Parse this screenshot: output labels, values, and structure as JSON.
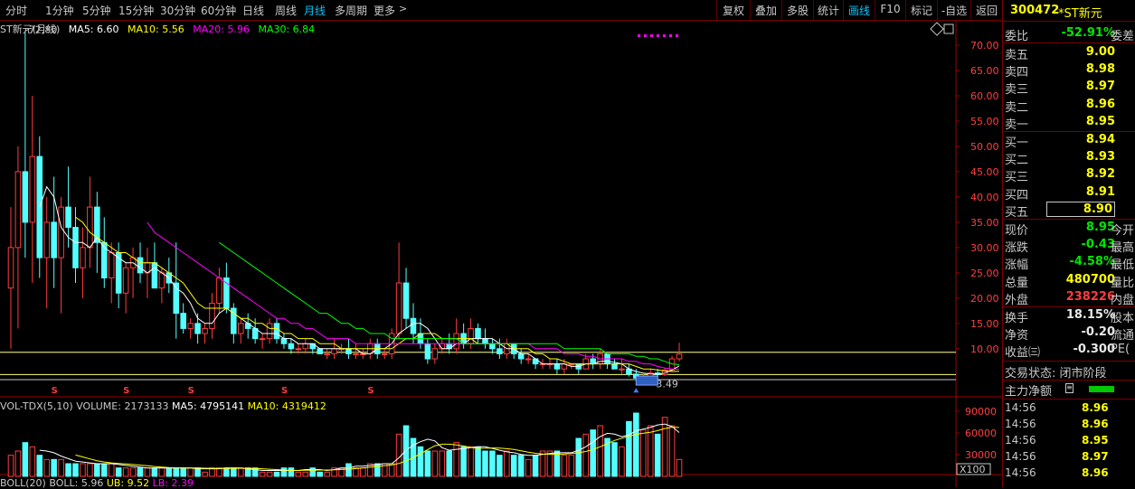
{
  "toolbar": {
    "periods": [
      "分时",
      "1分钟",
      "5分钟",
      "15分钟",
      "30分钟",
      "60分钟",
      "日线",
      "周线",
      "月线",
      "多周期",
      "更多"
    ],
    "active_period": "月线",
    "more_icon": "chevron-right-icon",
    "tools": [
      "复权",
      "叠加",
      "多股",
      "统计",
      "画线",
      "F10",
      "标记",
      "-自选",
      "返回"
    ],
    "active_tool": "画线"
  },
  "legend": {
    "title": "ST新元(月线)",
    "ma5": "MA5: 6.60",
    "ma10": "MA10: 5.56",
    "ma20": "MA20: 5.96",
    "ma30": "MA30: 6.84",
    "high_label": "72.80",
    "low_label": "3.49"
  },
  "volume_legend": {
    "name": "VOL-TDX(5,10)",
    "volume": "VOLUME: 2173133",
    "ma5": "MA5: 4795141",
    "ma10": "MA10: 4319412"
  },
  "boll_legend": {
    "name": "BOLL(20)",
    "boll": "BOLL: 5.96",
    "ub": "UB: 9.52",
    "lb": "LB: 2.39"
  },
  "colors": {
    "up": "#ff3c3c",
    "down": "#54ffff",
    "ma5": "#ffffff",
    "ma10": "#ffff00",
    "ma20": "#ff00ff",
    "ma30": "#00ff00",
    "axis": "#a00000"
  },
  "chart_data": {
    "type": "candlestick",
    "price_axis": {
      "ticks": [
        "70.00",
        "65.00",
        "60.00",
        "55.00",
        "50.00",
        "45.00",
        "40.00",
        "35.00",
        "30.00",
        "25.00",
        "20.00",
        "15.00",
        "10.00"
      ],
      "range": [
        3.0,
        75.0
      ]
    },
    "volume_axis": {
      "ticks": [
        "90000",
        "60000",
        "30000"
      ],
      "unit": "X100",
      "range": [
        0,
        100000
      ]
    },
    "horizontal_lines": [
      9.3,
      4.9
    ],
    "ohlc": [
      [
        22,
        38,
        10,
        30
      ],
      [
        30,
        50,
        14,
        45
      ],
      [
        45,
        72.8,
        28,
        35
      ],
      [
        35,
        60,
        23,
        48
      ],
      [
        48,
        52,
        24,
        28
      ],
      [
        28,
        40,
        18,
        35
      ],
      [
        35,
        44,
        22,
        28
      ],
      [
        28,
        40,
        17,
        38
      ],
      [
        38,
        46,
        30,
        34
      ],
      [
        34,
        38,
        23,
        26
      ],
      [
        26,
        34,
        20,
        30
      ],
      [
        30,
        44,
        26,
        38
      ],
      [
        38,
        41,
        25,
        31
      ],
      [
        31,
        36,
        22,
        24
      ],
      [
        24,
        31,
        19,
        29
      ],
      [
        29,
        31,
        18,
        21
      ],
      [
        21,
        27,
        17,
        26
      ],
      [
        26,
        30,
        20,
        28
      ],
      [
        28,
        31,
        23,
        25
      ],
      [
        25,
        30,
        20,
        27
      ],
      [
        27,
        31,
        22,
        22
      ],
      [
        22,
        26,
        19,
        25
      ],
      [
        25,
        28,
        21,
        23
      ],
      [
        23,
        31,
        12,
        17
      ],
      [
        17,
        19,
        13,
        14
      ],
      [
        14,
        16,
        12,
        15
      ],
      [
        15,
        17,
        11,
        13
      ],
      [
        13,
        15,
        11,
        14
      ],
      [
        14,
        21,
        12,
        19
      ],
      [
        19,
        26,
        17,
        24
      ],
      [
        24,
        27,
        17,
        18
      ],
      [
        18,
        19,
        11,
        13
      ],
      [
        13,
        16,
        11,
        15
      ],
      [
        15,
        17,
        12,
        14
      ],
      [
        14,
        16,
        11,
        12
      ],
      [
        12,
        13,
        10,
        12
      ],
      [
        12,
        16,
        11,
        15
      ],
      [
        15,
        16,
        11,
        12
      ],
      [
        12,
        13,
        10,
        11
      ],
      [
        11,
        12,
        9,
        10
      ],
      [
        10,
        11,
        9,
        10
      ],
      [
        10,
        12,
        9,
        11
      ],
      [
        11,
        11,
        9,
        10
      ],
      [
        10,
        10,
        9,
        9
      ],
      [
        9,
        10,
        8,
        9
      ],
      [
        9,
        12,
        8,
        10
      ],
      [
        10,
        11,
        9,
        10
      ],
      [
        10,
        12,
        8,
        9
      ],
      [
        9,
        11,
        8,
        9
      ],
      [
        9,
        10,
        8,
        9
      ],
      [
        9,
        12,
        8,
        11
      ],
      [
        11,
        12,
        8,
        9
      ],
      [
        9,
        10,
        8,
        9
      ],
      [
        9,
        14,
        8,
        13
      ],
      [
        13,
        31,
        12,
        23
      ],
      [
        23,
        26,
        14,
        16
      ],
      [
        16,
        19,
        11,
        13
      ],
      [
        13,
        16,
        10,
        11
      ],
      [
        11,
        12,
        7,
        8
      ],
      [
        8,
        11,
        7,
        10
      ],
      [
        10,
        12,
        9,
        11
      ],
      [
        11,
        13,
        9,
        10
      ],
      [
        10,
        16,
        9,
        13
      ],
      [
        13,
        15,
        10,
        11
      ],
      [
        11,
        16,
        10,
        14
      ],
      [
        14,
        15,
        11,
        12
      ],
      [
        12,
        14,
        10,
        11
      ],
      [
        11,
        12,
        9,
        10
      ],
      [
        10,
        12,
        8,
        9
      ],
      [
        9,
        12,
        8,
        11
      ],
      [
        11,
        11,
        8,
        9
      ],
      [
        9,
        10,
        7,
        8
      ],
      [
        8,
        9,
        7,
        8
      ],
      [
        8,
        8,
        6,
        7
      ],
      [
        7,
        8,
        6,
        7
      ],
      [
        7,
        8,
        6,
        7
      ],
      [
        7,
        8,
        5,
        6
      ],
      [
        6,
        8,
        5,
        7
      ],
      [
        7,
        7,
        6,
        7
      ],
      [
        7,
        7,
        5,
        6
      ],
      [
        6,
        9,
        6,
        8
      ],
      [
        8,
        9,
        6,
        7
      ],
      [
        7,
        10,
        6,
        9
      ],
      [
        9,
        9,
        6,
        7
      ],
      [
        7,
        8,
        6,
        6
      ],
      [
        6,
        8,
        5,
        6
      ],
      [
        6,
        7,
        4.5,
        5
      ],
      [
        5,
        6,
        3.49,
        4.2
      ],
      [
        4.2,
        5,
        3.6,
        4.5
      ],
      [
        4.5,
        6,
        4.2,
        5.2
      ],
      [
        5.2,
        6,
        4.3,
        4.9
      ],
      [
        4.9,
        6.2,
        4.6,
        5.8
      ],
      [
        5.8,
        8.6,
        5.5,
        8.0
      ],
      [
        8.0,
        11.2,
        7.5,
        8.95
      ]
    ],
    "ma5": [
      null,
      null,
      null,
      null,
      38,
      42,
      40,
      34,
      32,
      31,
      31,
      30,
      32,
      30,
      29,
      28,
      27,
      27,
      26,
      25,
      26,
      25,
      24,
      22,
      21,
      19,
      16,
      15,
      15,
      17,
      18,
      17,
      16,
      15,
      14,
      13,
      13,
      13,
      12,
      12,
      11,
      11,
      11,
      10,
      10,
      10,
      10,
      10,
      10,
      9,
      9,
      10,
      10,
      11,
      13,
      14,
      15,
      15,
      14,
      12,
      10,
      10,
      11,
      11,
      12,
      12,
      12,
      12,
      11,
      10,
      10,
      9,
      9,
      8,
      7,
      7,
      7,
      7,
      6.5,
      6.5,
      7,
      7,
      7.5,
      7.5,
      7.3,
      7,
      6,
      5.5,
      5.2,
      5,
      5,
      5.2,
      5.8,
      6.6
    ],
    "ma10": [
      null,
      null,
      null,
      null,
      null,
      null,
      null,
      null,
      null,
      36,
      35,
      33,
      32,
      31,
      30,
      29,
      29,
      28,
      27,
      27,
      27,
      26,
      25,
      24,
      23,
      21,
      19,
      18,
      18,
      18,
      18,
      17,
      16,
      16,
      15,
      15,
      14,
      14,
      13,
      13,
      12,
      12,
      12,
      11,
      11,
      11,
      10,
      10,
      10,
      10,
      10,
      10,
      10,
      10,
      11,
      12,
      12,
      13,
      13,
      13,
      12,
      12,
      12,
      12,
      12,
      11,
      11,
      11,
      11,
      11,
      10,
      10,
      10,
      9,
      9,
      8,
      8,
      7.5,
      7,
      7,
      7,
      7,
      7,
      7,
      7,
      7,
      7,
      6.5,
      6,
      6,
      5.8,
      5.6,
      5.5,
      5.56
    ],
    "ma20": [
      null,
      null,
      null,
      null,
      null,
      null,
      null,
      null,
      null,
      null,
      null,
      null,
      null,
      null,
      null,
      null,
      null,
      null,
      null,
      35,
      33,
      32,
      31,
      30,
      29,
      28,
      27,
      26,
      25,
      24,
      23,
      22,
      21,
      20,
      19,
      18,
      17,
      16,
      16,
      15,
      15,
      14,
      14,
      13,
      12,
      12,
      12,
      12,
      11,
      11,
      11,
      11,
      11,
      11,
      11,
      11,
      11,
      11,
      11,
      11,
      11,
      11,
      11,
      11,
      11,
      11,
      11,
      11,
      11,
      11,
      11,
      11,
      11,
      10,
      10,
      10,
      10,
      9,
      9,
      9,
      8.5,
      8.5,
      8,
      8,
      8,
      8,
      7.5,
      7.5,
      7,
      7,
      6.5,
      6.2,
      6,
      5.96
    ],
    "ma30": [
      null,
      null,
      null,
      null,
      null,
      null,
      null,
      null,
      null,
      null,
      null,
      null,
      null,
      null,
      null,
      null,
      null,
      null,
      null,
      null,
      null,
      null,
      null,
      null,
      null,
      null,
      null,
      null,
      null,
      31,
      30,
      29,
      28,
      27,
      26,
      25,
      24,
      23,
      22,
      21,
      20,
      19,
      18,
      17,
      17,
      16,
      15,
      15,
      14,
      14,
      13,
      13,
      13,
      12,
      12,
      12,
      12,
      12,
      12,
      12,
      12,
      12,
      12,
      11,
      11,
      11,
      11,
      11,
      11,
      11,
      11,
      11,
      11,
      11,
      11,
      11,
      11,
      10,
      10,
      10,
      10,
      10,
      10,
      9,
      9,
      9,
      9,
      8.5,
      8.5,
      8,
      8,
      7.5,
      7,
      6.84
    ],
    "volume": [
      5,
      6,
      8,
      7,
      5,
      4,
      4,
      4,
      3,
      3,
      3,
      3,
      3,
      3,
      3,
      2,
      2,
      2,
      2,
      2,
      2,
      2,
      2,
      2,
      2,
      2,
      2,
      1,
      2,
      2,
      2,
      2,
      2,
      2,
      2,
      1,
      1,
      1,
      2,
      2,
      1,
      1,
      2,
      1,
      1,
      2,
      2,
      3,
      2,
      2,
      3,
      3,
      3,
      3,
      10,
      12,
      9,
      7,
      6,
      6,
      6,
      6,
      8,
      7,
      7,
      7,
      6,
      6,
      5,
      6,
      5,
      5,
      4,
      5,
      6,
      6,
      6,
      5,
      5,
      9,
      10,
      11,
      12,
      9,
      8,
      7,
      13,
      15,
      11,
      12,
      10,
      14,
      12,
      4
    ],
    "vol_ma5": [
      null,
      null,
      null,
      null,
      6.2,
      6,
      5.6,
      4.8,
      4.2,
      3.6,
      3.4,
      3.2,
      3,
      3,
      3,
      2.8,
      2.6,
      2.4,
      2.2,
      2,
      2,
      2,
      2,
      2,
      2,
      2,
      1.8,
      1.8,
      1.8,
      1.8,
      2,
      2,
      2,
      1.8,
      1.6,
      1.4,
      1.4,
      1.4,
      1.4,
      1.4,
      1.4,
      1.6,
      1.6,
      1.6,
      1.4,
      1.6,
      2,
      2,
      2.4,
      2.4,
      2.6,
      2.8,
      3,
      3,
      4.4,
      6.2,
      7.4,
      8.2,
      8.8,
      8.4,
      6.8,
      6.2,
      6.4,
      6.6,
      6.8,
      7,
      7,
      6.6,
      6.2,
      5.8,
      5.6,
      5.2,
      5,
      5,
      5.2,
      5.4,
      5.6,
      5.6,
      5.6,
      6.2,
      7,
      8.2,
      9.4,
      10.2,
      10,
      9.4,
      9.8,
      10.8,
      11.2,
      11.6,
      12.2,
      12.4,
      11.8,
      10.4
    ],
    "ma_labels_price": {
      "high": 72.8,
      "low": 3.49
    },
    "s_markers": [
      6,
      16,
      25,
      38,
      50
    ]
  },
  "quote": {
    "code": "300472",
    "name": "*ST新元",
    "weibi_label": "委比",
    "weibi_value": "-52.91%",
    "weicha_label": "委差",
    "asks": [
      {
        "label": "卖五",
        "price": "9.00"
      },
      {
        "label": "卖四",
        "price": "8.98"
      },
      {
        "label": "卖三",
        "price": "8.97"
      },
      {
        "label": "卖二",
        "price": "8.96"
      },
      {
        "label": "卖一",
        "price": "8.95"
      }
    ],
    "bids": [
      {
        "label": "买一",
        "price": "8.94"
      },
      {
        "label": "买二",
        "price": "8.93"
      },
      {
        "label": "买三",
        "price": "8.92"
      },
      {
        "label": "买四",
        "price": "8.91"
      },
      {
        "label": "买五",
        "price": "8.90"
      }
    ],
    "stats1": [
      {
        "label": "现价",
        "value": "8.95",
        "ext": "今开",
        "cls": "g"
      },
      {
        "label": "涨跌",
        "value": "-0.43",
        "ext": "最高",
        "cls": "g"
      },
      {
        "label": "涨幅",
        "value": "-4.58%",
        "ext": "最低",
        "cls": "g"
      },
      {
        "label": "总量",
        "value": "480700",
        "ext": "量比",
        "cls": "y"
      },
      {
        "label": "外盘",
        "value": "238226",
        "ext": "内盘",
        "cls": "r"
      }
    ],
    "stats2": [
      {
        "label": "换手",
        "value": "18.15%",
        "ext": "股本",
        "cls": "w"
      },
      {
        "label": "净资",
        "value": "-0.20",
        "ext": "流通",
        "cls": "w"
      },
      {
        "label": "收益㈢",
        "value": "-0.300",
        "ext": "PE(",
        "cls": "w"
      }
    ],
    "trade_status": "交易状态: 闭市阶段",
    "main_net": "主力净额",
    "ticks": [
      {
        "time": "14:56",
        "price": "8.96"
      },
      {
        "time": "14:56",
        "price": "8.96"
      },
      {
        "time": "14:56",
        "price": "8.95"
      },
      {
        "time": "14:56",
        "price": "8.97"
      },
      {
        "time": "14:56",
        "price": "8.96"
      }
    ]
  }
}
